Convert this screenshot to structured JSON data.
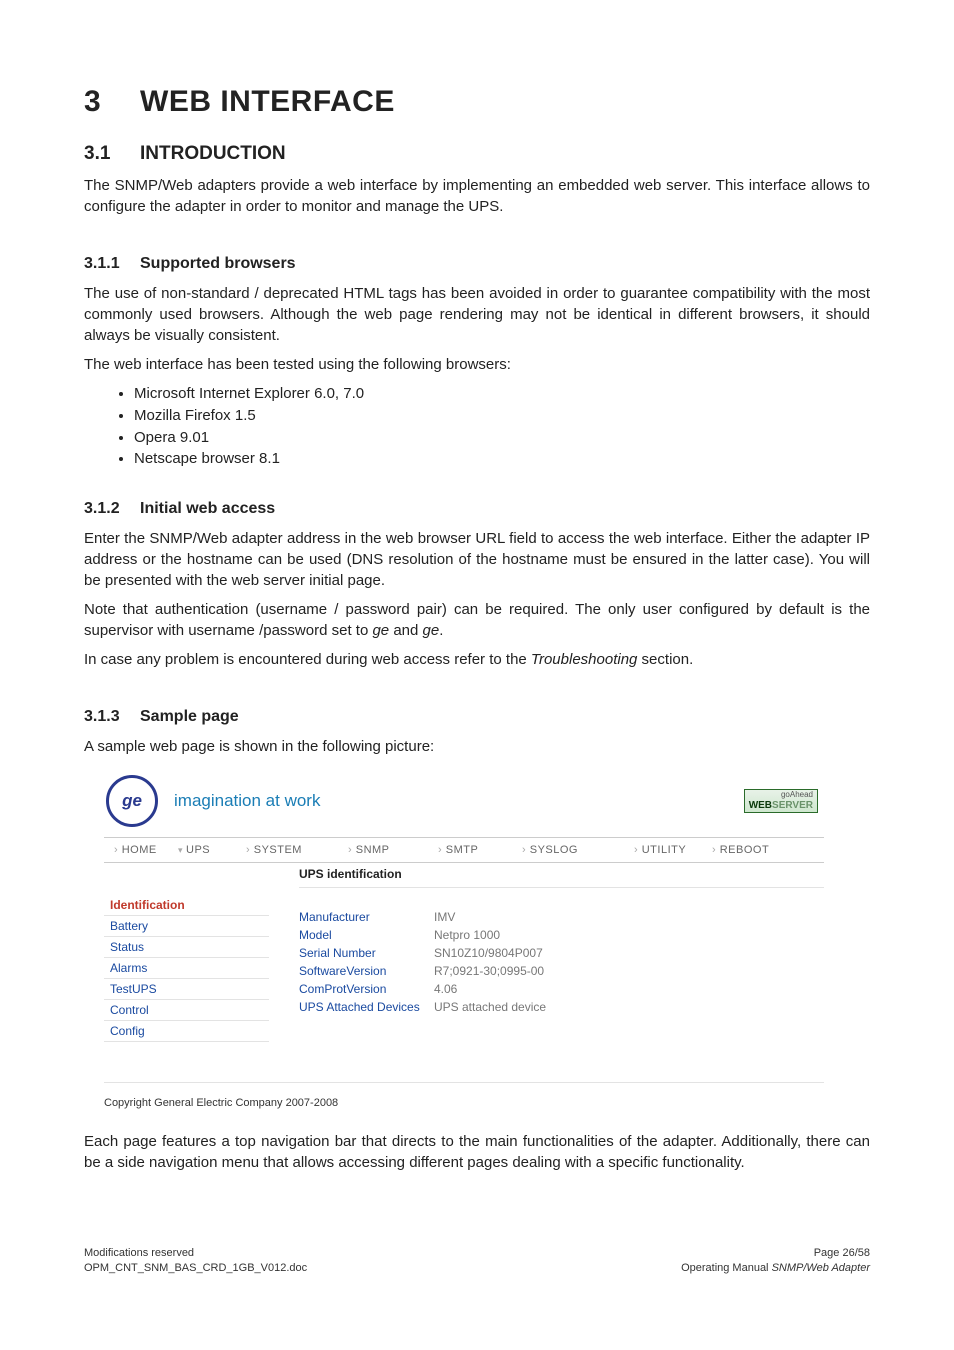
{
  "chapter": {
    "num": "3",
    "title": "WEB INTERFACE"
  },
  "s_intro": {
    "num": "3.1",
    "title": "INTRODUCTION",
    "p1": "The SNMP/Web adapters provide a web interface by implementing an embedded web server. This interface allows to configure the adapter in order to monitor and manage the UPS."
  },
  "s_browsers": {
    "num": "3.1.1",
    "title": "Supported browsers",
    "p1": "The use of non-standard / deprecated HTML tags has been avoided in order to guarantee compatibility with the most commonly used browsers. Although the web page rendering may not be identical in different browsers, it should always be visually consistent.",
    "p2": "The web interface has been tested using the following browsers:",
    "list": [
      "Microsoft Internet Explorer 6.0, 7.0",
      "Mozilla Firefox 1.5",
      "Opera 9.01",
      "Netscape browser 8.1"
    ]
  },
  "s_access": {
    "num": "3.1.2",
    "title": "Initial web access",
    "p1": "Enter the SNMP/Web adapter address in the web browser URL field to access the web interface. Either the adapter IP address or the hostname can be used (DNS resolution of the hostname must be ensured in the latter case).  You will be presented with the web server initial page.",
    "p2a": "Note that authentication (username / password pair) can be required. The only user configured by default is the supervisor with username /password set to ",
    "p2b": "ge",
    "p2c": " and ",
    "p2d": "ge",
    "p2e": ".",
    "p3a": "In case any problem is encountered during web access refer to the ",
    "p3b": "Troubleshooting",
    "p3c": " section."
  },
  "s_sample": {
    "num": "3.1.3",
    "title": "Sample page",
    "p1": "A sample web page is shown in the following picture:",
    "after": "Each page features a top navigation bar that directs to the main functionalities of the adapter. Additionally, there can be a side navigation menu that allows accessing different pages dealing with a specific functionality."
  },
  "shot": {
    "tagline": "imagination at work",
    "ws_go": "goAhead",
    "ws_web": "WEB",
    "ws_server": "SERVER",
    "nav": {
      "home": "HOME",
      "ups": "UPS",
      "system": "SYSTEM",
      "snmp": "SNMP",
      "smtp": "SMTP",
      "syslog": "SYSLOG",
      "utility": "UTILITY",
      "reboot": "REBOOT"
    },
    "side": [
      "Identification",
      "Battery",
      "Status",
      "Alarms",
      "TestUPS",
      "Control",
      "Config"
    ],
    "section": "UPS identification",
    "rows": [
      {
        "k": "Manufacturer",
        "v": "IMV"
      },
      {
        "k": "Model",
        "v": "Netpro 1000"
      },
      {
        "k": "Serial Number",
        "v": "SN10Z10/9804P007"
      },
      {
        "k": "SoftwareVersion",
        "v": "R7;0921-30;0995-00"
      },
      {
        "k": "ComProtVersion",
        "v": "4.06"
      },
      {
        "k": "UPS Attached Devices",
        "v": "UPS attached device"
      }
    ],
    "copyright": "Copyright General Electric Company 2007-2008"
  },
  "footer": {
    "l1": "Modifications reserved",
    "l2": "OPM_CNT_SNM_BAS_CRD_1GB_V012.doc",
    "r1": "Page 26/58",
    "r2a": "Operating Manual ",
    "r2b": "SNMP/Web Adapter"
  }
}
